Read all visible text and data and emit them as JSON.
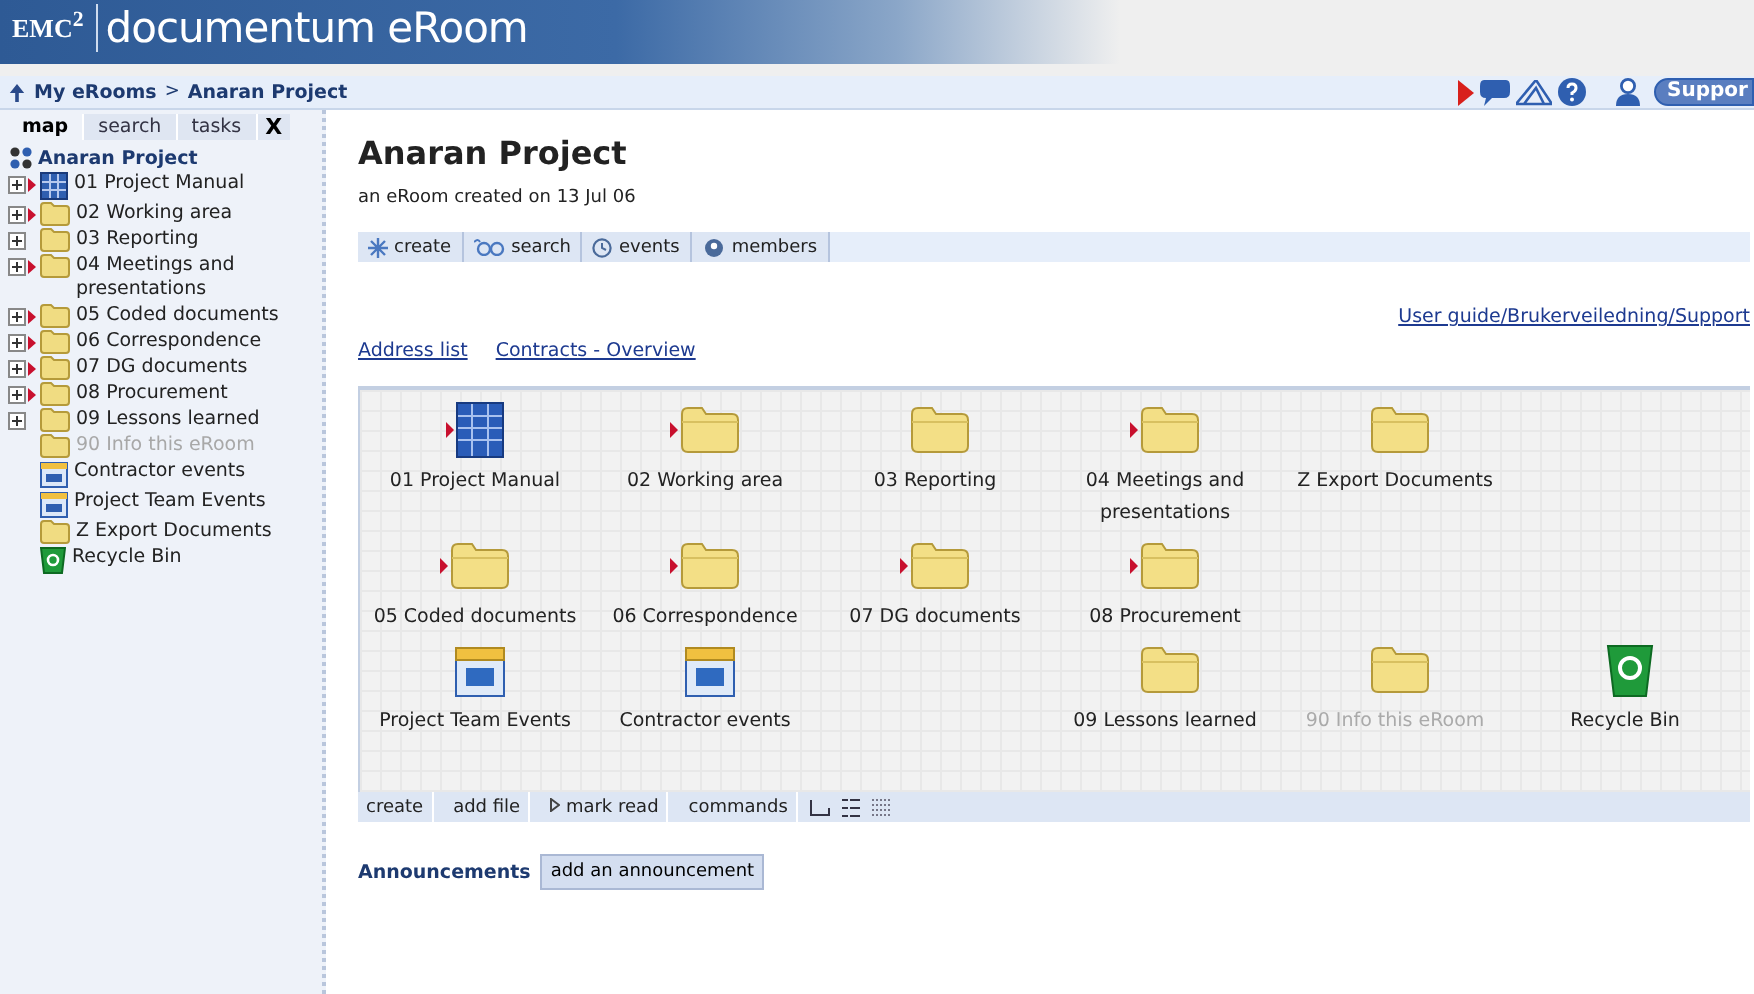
{
  "banner": {
    "brand": "EMC$^{2}$",
    "product": "documentum eRoom"
  },
  "breadcrumb": {
    "items": [
      "My eRooms",
      "Anaran Project"
    ],
    "separator": ">"
  },
  "top_right": {
    "support_button": "Suppor"
  },
  "sidebar": {
    "tabs": [
      {
        "label": "map",
        "selected": true
      },
      {
        "label": "search",
        "selected": false
      },
      {
        "label": "tasks",
        "selected": false
      }
    ],
    "close": "X",
    "root": "Anaran Project",
    "items": [
      {
        "label": "01 Project Manual",
        "kind": "manual",
        "expandable": true,
        "new": true,
        "dimmed": false
      },
      {
        "label": "02 Working area",
        "kind": "folder",
        "expandable": true,
        "new": true,
        "dimmed": false
      },
      {
        "label": "03 Reporting",
        "kind": "folder",
        "expandable": true,
        "new": false,
        "dimmed": false
      },
      {
        "label": "04 Meetings and presentations",
        "kind": "folder",
        "expandable": true,
        "new": true,
        "dimmed": false
      },
      {
        "label": "05 Coded documents",
        "kind": "folder",
        "expandable": true,
        "new": true,
        "dimmed": false
      },
      {
        "label": "06 Correspondence",
        "kind": "folder",
        "expandable": true,
        "new": true,
        "dimmed": false
      },
      {
        "label": "07 DG documents",
        "kind": "folder",
        "expandable": true,
        "new": true,
        "dimmed": false
      },
      {
        "label": "08 Procurement",
        "kind": "folder",
        "expandable": true,
        "new": true,
        "dimmed": false
      },
      {
        "label": "09 Lessons learned",
        "kind": "folder",
        "expandable": true,
        "new": false,
        "dimmed": false
      },
      {
        "label": "90 Info this eRoom",
        "kind": "folder",
        "expandable": false,
        "new": false,
        "dimmed": true
      },
      {
        "label": "Contractor events",
        "kind": "calendar",
        "expandable": false,
        "new": false,
        "dimmed": false
      },
      {
        "label": "Project Team Events",
        "kind": "calendar",
        "expandable": false,
        "new": false,
        "dimmed": false
      },
      {
        "label": "Z Export Documents",
        "kind": "folder",
        "expandable": false,
        "new": false,
        "dimmed": false
      },
      {
        "label": "Recycle Bin",
        "kind": "recycle",
        "expandable": false,
        "new": false,
        "dimmed": false
      }
    ]
  },
  "page": {
    "title": "Anaran Project",
    "subtitle": "an eRoom created on 13 Jul 06",
    "toolbar": [
      {
        "label": "create",
        "kind": "create"
      },
      {
        "label": "search",
        "kind": "search"
      },
      {
        "label": "events",
        "kind": "events"
      },
      {
        "label": "members",
        "kind": "members"
      }
    ],
    "right_link": "User guide/Brukerveiledning/Support",
    "links": [
      "Address list",
      "Contracts - Overview"
    ],
    "grid_rows": [
      [
        {
          "label": "01 Project Manual",
          "kind": "manual",
          "new": true,
          "dimmed": false
        },
        {
          "label": "02 Working area",
          "kind": "folder",
          "new": true,
          "dimmed": false
        },
        {
          "label": "03 Reporting",
          "kind": "folder",
          "new": false,
          "dimmed": false
        },
        {
          "label": "04 Meetings and presentations",
          "kind": "folder",
          "new": true,
          "dimmed": false
        },
        {
          "label": "Z Export Documents",
          "kind": "folder",
          "new": false,
          "dimmed": false
        }
      ],
      [
        {
          "label": "05 Coded documents",
          "kind": "folder",
          "new": true,
          "dimmed": false
        },
        {
          "label": "06 Correspondence",
          "kind": "folder",
          "new": true,
          "dimmed": false
        },
        {
          "label": "07 DG documents",
          "kind": "folder",
          "new": true,
          "dimmed": false
        },
        {
          "label": "08 Procurement",
          "kind": "folder",
          "new": true,
          "dimmed": false
        }
      ],
      [
        {
          "label": "Project Team Events",
          "kind": "calendar",
          "new": false,
          "dimmed": false
        },
        {
          "label": "Contractor events",
          "kind": "calendar",
          "new": false,
          "dimmed": false
        },
        {
          "kind": "blank"
        },
        {
          "label": "09 Lessons learned",
          "kind": "folder",
          "new": false,
          "dimmed": false
        },
        {
          "label": "90 Info this eRoom",
          "kind": "folder",
          "new": false,
          "dimmed": true
        },
        {
          "label": "Recycle Bin",
          "kind": "recycle",
          "new": false,
          "dimmed": false
        }
      ]
    ],
    "bottom_toolbar": [
      {
        "label": "create",
        "kind": "text"
      },
      {
        "label": "add file",
        "kind": "text"
      },
      {
        "label": "mark read",
        "kind": "mark"
      },
      {
        "label": "commands",
        "kind": "text"
      },
      {
        "kind": "view-icons"
      },
      {
        "kind": "view-list"
      },
      {
        "kind": "view-details"
      }
    ],
    "announcements": {
      "label": "Announcements",
      "button": "add an announcement"
    }
  }
}
